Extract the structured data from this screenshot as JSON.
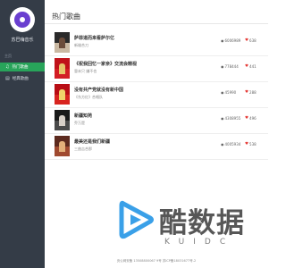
{
  "app": {
    "name": "苏巴嗨音乐"
  },
  "sidebar": {
    "section_label": "主页",
    "items": [
      {
        "icon": "music-note-icon",
        "glyph": "♫",
        "label": "热门歌曲",
        "active": true
      },
      {
        "icon": "chart-icon",
        "glyph": "▤",
        "label": "经典歌曲",
        "active": false
      }
    ]
  },
  "main": {
    "title": "热门歌曲",
    "songs": [
      {
        "title": "萨菲道而来看萨尔亿",
        "artist": "新雄合刀",
        "plays": "6006989",
        "likes": "638",
        "cover": {
          "top": "#2a2a2a",
          "bottom": "#c9b8a2",
          "fig": "#6b4c3a"
        }
      },
      {
        "title": "《祝我回忆一家亲》交流会精视",
        "artist": "冒未只 嫌不也",
        "plays": "778444",
        "likes": "441",
        "cover": {
          "top": "#c0121a",
          "bottom": "#d31d24",
          "fig": "#e7c56b"
        }
      },
      {
        "title": "没有共产党就没有新中国",
        "artist": "《东方红》合唱队",
        "plays": "45990",
        "likes": "288",
        "cover": {
          "top": "#b80d14",
          "bottom": "#d8241f",
          "fig": "#f0d36a"
        }
      },
      {
        "title": "新疆知苑",
        "artist": "乔万是",
        "plays": "4308955",
        "likes": "496",
        "cover": {
          "top": "#1a1a1a",
          "bottom": "#4a4a4a",
          "fig": "#d8d0c8"
        }
      },
      {
        "title": "最美还是我们新疆",
        "artist": "三曲吉合那",
        "plays": "4005934",
        "likes": "538",
        "cover": {
          "top": "#5c2a1e",
          "bottom": "#a04a30",
          "fig": "#e3b07a"
        }
      }
    ]
  },
  "footer": {
    "text": "页公网安备 13508800067 9号    苏ICP备18031677号-2"
  },
  "watermark": {
    "text": "酷数据",
    "sub": "KUIDC"
  },
  "colors": {
    "sidebar_bg": "#343c47",
    "active_green": "#28a45a",
    "heart_red": "#e53935",
    "logo_purple": "#6a3fd0",
    "watermark_play": "#3aa0e8"
  }
}
